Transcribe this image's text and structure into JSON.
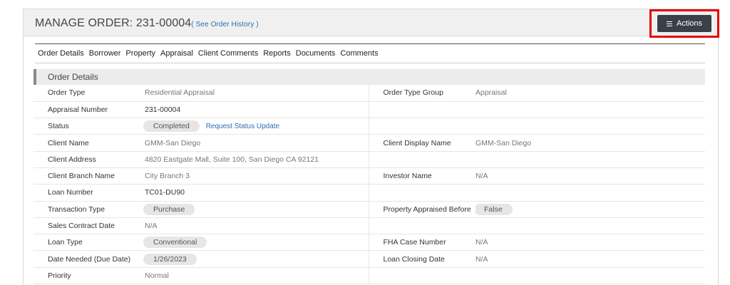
{
  "header": {
    "title_prefix": "MANAGE ORDER: ",
    "order_number": "231-00004",
    "history_link": "( See Order History )",
    "actions_label": "Actions"
  },
  "tabs": [
    "Order Details",
    "Borrower",
    "Property",
    "Appraisal",
    "Client Comments",
    "Reports",
    "Documents",
    "Comments"
  ],
  "section": {
    "title": "Order Details"
  },
  "rows": [
    {
      "l1": "Order Type",
      "v1": "Residential Appraisal",
      "l2": "Order Type Group",
      "v2": "Appraisal"
    },
    {
      "l1": "Appraisal Number",
      "v1": "231-00004",
      "l2": "",
      "v2": ""
    },
    {
      "l1": "Status",
      "v1": "Completed",
      "link": "Request Status Update",
      "l2": "",
      "v2": ""
    },
    {
      "l1": "Client Name",
      "v1": "GMM-San Diego",
      "l2": "Client Display Name",
      "v2": "GMM-San Diego"
    },
    {
      "l1": "Client Address",
      "v1": "4820 Eastgate Mall, Suite 100, San Diego CA 92121",
      "l2": "",
      "v2": ""
    },
    {
      "l1": "Client Branch Name",
      "v1": "City Branch 3",
      "l2": "Investor Name",
      "v2": "N/A"
    },
    {
      "l1": "Loan Number",
      "v1": "TC01-DU90",
      "l2": "",
      "v2": ""
    },
    {
      "l1": "Transaction Type",
      "v1": "Purchase",
      "l2": "Property Appraised Before",
      "v2": "False"
    },
    {
      "l1": "Sales Contract Date",
      "v1": "N/A",
      "l2": "",
      "v2": ""
    },
    {
      "l1": "Loan Type",
      "v1": "Conventional",
      "l2": "FHA Case Number",
      "v2": "N/A"
    },
    {
      "l1": "Date Needed (Due Date)",
      "v1": "1/26/2023",
      "l2": "Loan Closing Date",
      "v2": "N/A"
    },
    {
      "l1": "Priority",
      "v1": "Normal",
      "l2": "",
      "v2": ""
    }
  ]
}
